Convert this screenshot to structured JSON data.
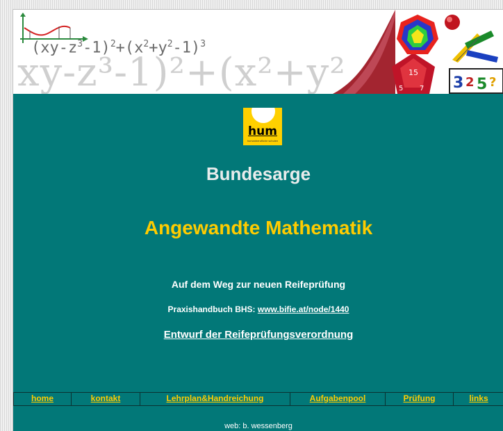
{
  "banner": {
    "formula_front": "(xy-z³-1)²+(x²+y²-1)³",
    "formula_back": "xy-z³-1)²+(x²+y²"
  },
  "logo": {
    "text": "hum",
    "small_text": "humanberufliche schulen"
  },
  "main": {
    "title": "Bundesarge",
    "subtitle": "Angewandte Mathematik",
    "weg": "Auf dem Weg zur neuen Reifeprüfung",
    "praxis_prefix": "Praxishandbuch BHS: ",
    "praxis_link": "www.bifie.at/node/1440",
    "entwurf_link": "Entwurf der Reifeprüfungsverordnung"
  },
  "nav": {
    "items": [
      {
        "label": "home"
      },
      {
        "label": "kontakt"
      },
      {
        "label": "Lehrplan&Handreichung"
      },
      {
        "label": "Aufgabenpool"
      },
      {
        "label": "Prüfung"
      },
      {
        "label": "links"
      }
    ]
  },
  "footer": {
    "text": "web: b. wessenberg"
  },
  "colors": {
    "teal": "#027878",
    "yellow": "#ffcc00",
    "logo_yellow": "#ffd000"
  }
}
